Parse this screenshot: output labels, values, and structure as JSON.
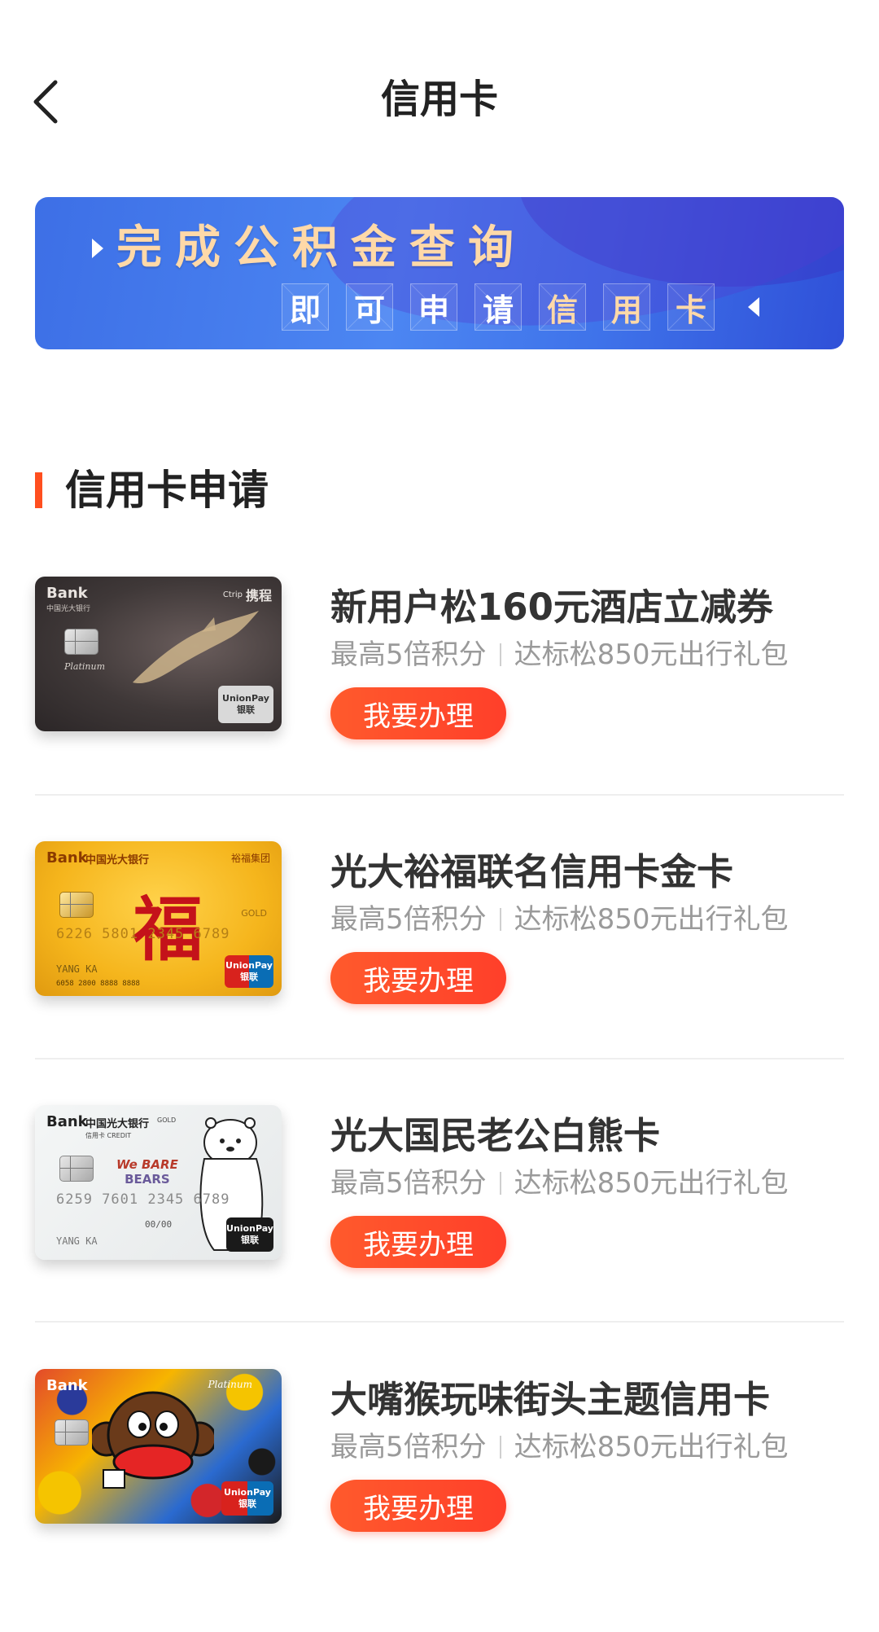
{
  "header": {
    "title": "信用卡"
  },
  "banner": {
    "headline": "完成公积金查询",
    "subline_chars": [
      "即",
      "可",
      "申",
      "请",
      "信",
      "用",
      "卡"
    ]
  },
  "section": {
    "title": "信用卡申请"
  },
  "cards": [
    {
      "name": "新用户松160元酒店立减券",
      "perk_1": "最高5倍积分",
      "perk_2": "达标松850元出行礼包",
      "button": "我要办理",
      "art": {
        "bank_mark": "Bank",
        "bank_sub": "中国光大银行",
        "cobrand": "携程",
        "cobrand_latin": "Ctrip",
        "tier": "Platinum",
        "network_top": "UnionPay",
        "network_bottom": "银联"
      }
    },
    {
      "name": "光大裕福联名信用卡金卡",
      "perk_1": "最高5倍积分",
      "perk_2": "达标松850元出行礼包",
      "button": "我要办理",
      "art": {
        "bank_mark": "Bank",
        "bank_name": "中国光大银行",
        "cobrand": "裕福集团",
        "glyph": "福",
        "number": "6226 5801 2345 6789",
        "holder": "YANG KA",
        "number_small": "6058 2800 8888 8888",
        "tier": "GOLD",
        "network_top": "UnionPay",
        "network_bottom": "银联"
      }
    },
    {
      "name": "光大国民老公白熊卡",
      "perk_1": "最高5倍积分",
      "perk_2": "达标松850元出行礼包",
      "button": "我要办理",
      "art": {
        "bank_mark": "Bank",
        "bank_name": "中国光大银行",
        "bank_sub": "信用卡 CREDIT",
        "tier": "GOLD",
        "theme_line1": "We BARE",
        "theme_line2": "BEARS",
        "number": "6259 7601 2345 6789",
        "expiry": "00/00",
        "holder": "YANG KA",
        "network_top": "UnionPay",
        "network_bottom": "银联"
      }
    },
    {
      "name": "大嘴猴玩味街头主题信用卡",
      "perk_1": "最高5倍积分",
      "perk_2": "达标松850元出行礼包",
      "button": "我要办理",
      "art": {
        "bank_mark": "Bank",
        "tier": "Platinum",
        "network_top": "UnionPay",
        "network_bottom": "银联"
      }
    }
  ],
  "colors": {
    "accent": "#ff4f1f",
    "button_start": "#ff5a2c",
    "button_end": "#ff3f2a",
    "banner_blue": "#4c86f2",
    "banner_gold_text": "#ffd9a8",
    "perk_gray": "#9a9a9a"
  }
}
